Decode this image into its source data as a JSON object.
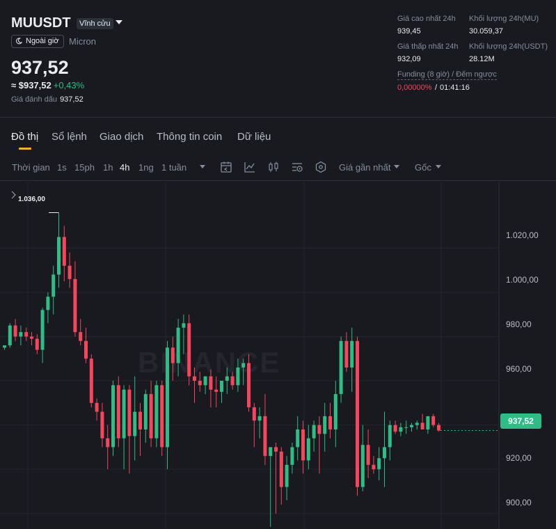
{
  "header": {
    "symbol": "MUUSDT",
    "perpetual_badge": "Vĩnh cửu",
    "after_hours": "Ngoài giờ",
    "underlying": "Micron",
    "last_price": "937,52",
    "usd_price": "≈ $937,52",
    "change_pct": "+0,43%",
    "mark_price_label": "Giá đánh dấu",
    "mark_price": "937,52",
    "stats": {
      "high_label": "Giá cao nhất 24h",
      "high_value": "939,45",
      "vol_mu_label": "Khối lượng 24h(MU)",
      "vol_mu_value": "30.059,37",
      "low_label": "Giá thấp nhất 24h",
      "low_value": "932,09",
      "vol_usdt_label": "Khối lượng 24h(USDT)",
      "vol_usdt_value": "28.12M",
      "funding_label": "Funding (8 giờ) / Đếm ngược",
      "funding_rate": "0,00000%",
      "funding_separator": "/",
      "countdown": "01:41:16"
    }
  },
  "tabs": [
    "Đồ thị",
    "Sổ lệnh",
    "Giao dịch",
    "Thông tin coin",
    "Dữ liệu"
  ],
  "toolbar": {
    "time_label": "Thời gian",
    "intervals": [
      "1s",
      "15ph",
      "1h",
      "4h",
      "1ng",
      "1 tuần"
    ],
    "active_interval": "4h",
    "price_source": "Giá gần nhất",
    "scale_mode": "Gốc",
    "icons": [
      "calendar-icon",
      "indicator-icon",
      "candle-type-icon",
      "settings-icon",
      "depth-icon"
    ]
  },
  "chart_data": {
    "type": "candlestick",
    "symbol": "MUUSDT",
    "interval": "4h",
    "yticks": [
      "1.020,00",
      "1.000,00",
      "980,00",
      "960,00",
      "920,00",
      "900,00"
    ],
    "ylim": [
      893,
      1050
    ],
    "high_marker": "1.036,00",
    "current_price_label": "937,52",
    "current_price": 937.52,
    "watermark": "BINANCE",
    "up_color": "#2ebd85",
    "down_color": "#f6465d",
    "grid": true,
    "candles": [
      [
        975,
        976,
        974,
        976
      ],
      [
        976,
        986,
        975,
        985
      ],
      [
        985,
        988,
        978,
        980
      ],
      [
        980,
        985,
        976,
        982
      ],
      [
        982,
        984,
        978,
        980
      ],
      [
        980,
        982,
        976,
        979
      ],
      [
        979,
        981,
        972,
        974
      ],
      [
        974,
        993,
        968,
        992
      ],
      [
        992,
        1000,
        986,
        998
      ],
      [
        998,
        1012,
        990,
        1008
      ],
      [
        1008,
        1036,
        1002,
        1025
      ],
      [
        1025,
        1030,
        1005,
        1012
      ],
      [
        1012,
        1018,
        1002,
        1006
      ],
      [
        1006,
        1014,
        980,
        982
      ],
      [
        982,
        988,
        976,
        978
      ],
      [
        978,
        984,
        968,
        970
      ],
      [
        970,
        972,
        948,
        950
      ],
      [
        950,
        952,
        942,
        946
      ],
      [
        946,
        950,
        930,
        934
      ],
      [
        934,
        940,
        920,
        930
      ],
      [
        930,
        960,
        926,
        958
      ],
      [
        958,
        962,
        930,
        934
      ],
      [
        934,
        958,
        920,
        956
      ],
      [
        956,
        958,
        918,
        935
      ],
      [
        935,
        962,
        924,
        946
      ],
      [
        946,
        950,
        926,
        938
      ],
      [
        938,
        956,
        932,
        954
      ],
      [
        954,
        960,
        930,
        934
      ],
      [
        934,
        960,
        930,
        958
      ],
      [
        958,
        960,
        926,
        930
      ],
      [
        930,
        978,
        920,
        975
      ],
      [
        975,
        980,
        960,
        968
      ],
      [
        968,
        988,
        962,
        984
      ],
      [
        984,
        990,
        972,
        986
      ],
      [
        986,
        990,
        958,
        962
      ],
      [
        962,
        966,
        950,
        960
      ],
      [
        960,
        964,
        955,
        958
      ],
      [
        958,
        962,
        954,
        962
      ],
      [
        962,
        965,
        948,
        956
      ],
      [
        956,
        962,
        948,
        955
      ],
      [
        955,
        960,
        950,
        960
      ],
      [
        960,
        966,
        954,
        962
      ],
      [
        962,
        964,
        956,
        958
      ],
      [
        958,
        970,
        955,
        966
      ],
      [
        966,
        970,
        958,
        968
      ],
      [
        968,
        972,
        946,
        948
      ],
      [
        948,
        950,
        930,
        942
      ],
      [
        942,
        948,
        934,
        944
      ],
      [
        944,
        954,
        922,
        926
      ],
      [
        926,
        930,
        894,
        930
      ],
      [
        930,
        932,
        900,
        928
      ],
      [
        928,
        930,
        904,
        912
      ],
      [
        912,
        926,
        906,
        922
      ],
      [
        922,
        932,
        918,
        930
      ],
      [
        930,
        944,
        924,
        938
      ],
      [
        938,
        942,
        918,
        924
      ],
      [
        924,
        940,
        920,
        934
      ],
      [
        934,
        942,
        928,
        940
      ],
      [
        940,
        944,
        918,
        936
      ],
      [
        936,
        950,
        928,
        944
      ],
      [
        944,
        950,
        934,
        938
      ],
      [
        938,
        960,
        930,
        954
      ],
      [
        954,
        980,
        950,
        978
      ],
      [
        978,
        982,
        964,
        966
      ],
      [
        966,
        984,
        955,
        978
      ],
      [
        978,
        980,
        908,
        912
      ],
      [
        912,
        940,
        910,
        931
      ],
      [
        931,
        938,
        916,
        922
      ],
      [
        922,
        926,
        918,
        920
      ],
      [
        920,
        930,
        915,
        925
      ],
      [
        925,
        946,
        912,
        930
      ],
      [
        930,
        942,
        924,
        940
      ],
      [
        940,
        942,
        936,
        937
      ],
      [
        937,
        941,
        935,
        939
      ],
      [
        939,
        942,
        936,
        939
      ],
      [
        939,
        941,
        937,
        940
      ],
      [
        940,
        942,
        938,
        941
      ],
      [
        941,
        945,
        938,
        938
      ],
      [
        938,
        944,
        936,
        944
      ],
      [
        944,
        945,
        939,
        940
      ],
      [
        940,
        941,
        937,
        937.52
      ]
    ]
  }
}
